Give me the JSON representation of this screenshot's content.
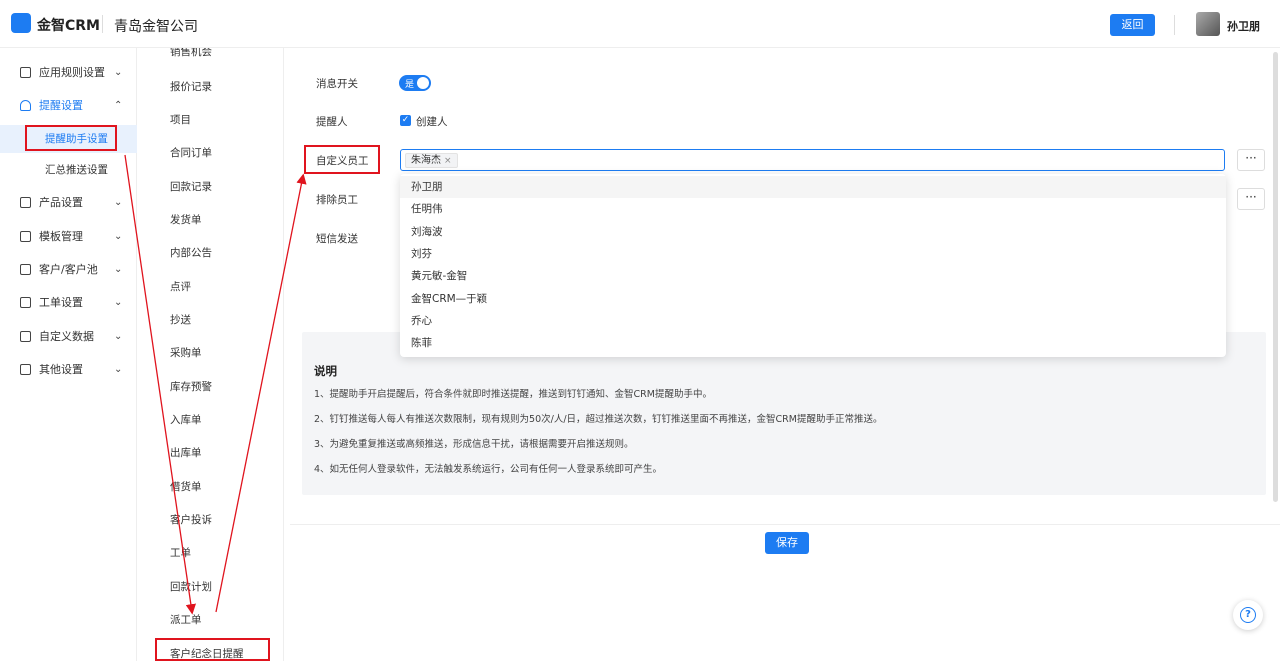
{
  "header": {
    "logo": "金智CRM",
    "company": "青岛金智公司",
    "back_label": "返回",
    "username": "孙卫朋"
  },
  "sidebar": {
    "items": [
      {
        "label": "应用规则设置",
        "icon": "file-icon"
      },
      {
        "label": "提醒设置",
        "icon": "bell-icon"
      },
      {
        "label": "产品设置",
        "icon": "cube-icon"
      },
      {
        "label": "模板管理",
        "icon": "template-icon"
      },
      {
        "label": "客户/客户池",
        "icon": "customer-icon"
      },
      {
        "label": "工单设置",
        "icon": "ticket-icon"
      },
      {
        "label": "自定义数据",
        "icon": "tools-icon"
      },
      {
        "label": "其他设置",
        "icon": "grid-icon"
      }
    ],
    "sub_items": [
      "提醒助手设置",
      "汇总推送设置"
    ]
  },
  "midlist": {
    "items": [
      "销售机会",
      "报价记录",
      "项目",
      "合同订单",
      "回款记录",
      "发货单",
      "内部公告",
      "点评",
      "抄送",
      "采购单",
      "库存预警",
      "入库单",
      "出库单",
      "借货单",
      "客户投诉",
      "工单",
      "回款计划",
      "派工单",
      "客户纪念日提醒"
    ]
  },
  "form": {
    "switch_label": "消息开关",
    "switch_value": "是",
    "reminder_label": "提醒人",
    "reminder_option": "创建人",
    "custom_label": "自定义员工",
    "custom_tag": "朱海杰",
    "exclude_label": "排除员工",
    "sms_label": "短信发送",
    "more": "···"
  },
  "dropdown": {
    "options": [
      "孙卫朋",
      "任明伟",
      "刘海波",
      "刘芬",
      "黄元敏-金智",
      "金智CRM—于颖",
      "乔心",
      "陈菲"
    ]
  },
  "notes": {
    "title": "说明",
    "lines": [
      "1、提醒助手开启提醒后，符合条件就即时推送提醒，推送到钉钉通知、金智CRM提醒助手中。",
      "2、钉钉推送每人每人有推送次数限制，现有规则为50次/人/日，超过推送次数，钉钉推送里面不再推送，金智CRM提醒助手正常推送。",
      "3、为避免重复推送或高频推送，形成信息干扰，请根据需要开启推送规则。",
      "4、如无任何人登录软件，无法触发系统运行，公司有任何一人登录系统即可产生。"
    ]
  },
  "save_label": "保存",
  "help": "?",
  "colors": {
    "accent": "#1d7cf2",
    "highlight": "#e0141e"
  }
}
